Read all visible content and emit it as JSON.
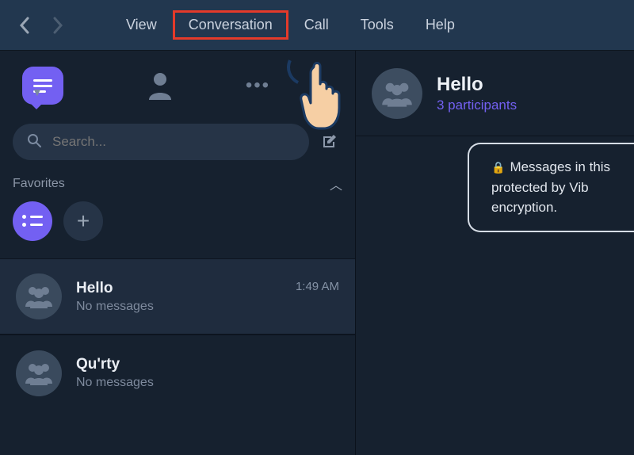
{
  "menubar": {
    "items": [
      "View",
      "Conversation",
      "Call",
      "Tools",
      "Help"
    ],
    "highlighted_index": 1
  },
  "sidebar": {
    "search_placeholder": "Search...",
    "favorites_label": "Favorites",
    "conversations": [
      {
        "name": "Hello",
        "subtitle": "No messages",
        "time": "1:49 AM",
        "active": true
      },
      {
        "name": "Qu'rty",
        "subtitle": "No messages",
        "time": "",
        "active": false
      }
    ]
  },
  "content": {
    "title": "Hello",
    "subtitle": "3 participants",
    "system_message": "Messages in this \nprotected by Vib\nencryption."
  }
}
